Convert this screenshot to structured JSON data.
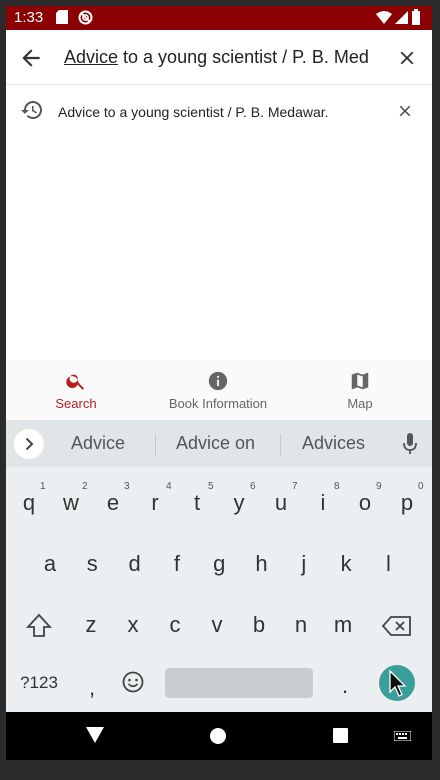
{
  "status_bar": {
    "time": "1:33",
    "background": "#8b0000",
    "left_icons": [
      "sd-card-icon",
      "blocked-icon"
    ],
    "right_icons": [
      "wifi-icon",
      "signal-icon",
      "battery-icon"
    ]
  },
  "search": {
    "query_underlined": "Advice",
    "query_rest": " to a young scientist / P. B. Med",
    "back_icon": "back-arrow-icon",
    "clear_icon": "close-icon"
  },
  "suggestions": [
    {
      "text": "Advice to a young scientist / P. B. Medawar.",
      "icon": "history-icon",
      "remove_icon": "close-icon"
    }
  ],
  "bottom_nav": {
    "items": [
      {
        "label": "Search",
        "icon": "search-icon",
        "active": true
      },
      {
        "label": "Book Information",
        "icon": "info-icon",
        "active": false
      },
      {
        "label": "Map",
        "icon": "map-icon",
        "active": false
      }
    ],
    "accent_color": "#b71c1c"
  },
  "keyboard": {
    "word_suggestions": [
      "Advice",
      "Advice on",
      "Advices"
    ],
    "row1": [
      "q",
      "w",
      "e",
      "r",
      "t",
      "y",
      "u",
      "i",
      "o",
      "p"
    ],
    "row1_hints": [
      "1",
      "2",
      "3",
      "4",
      "5",
      "6",
      "7",
      "8",
      "9",
      "0"
    ],
    "row2": [
      "a",
      "s",
      "d",
      "f",
      "g",
      "h",
      "j",
      "k",
      "l"
    ],
    "row3": [
      "z",
      "x",
      "c",
      "v",
      "b",
      "n",
      "m"
    ],
    "symbols_label": "?123",
    "comma": ",",
    "period": ".",
    "enter_color": "#3a9e9a"
  },
  "system_nav": {
    "buttons": [
      "back-triangle-icon",
      "home-circle-icon",
      "recents-square-icon",
      "keyboard-switch-icon"
    ]
  }
}
